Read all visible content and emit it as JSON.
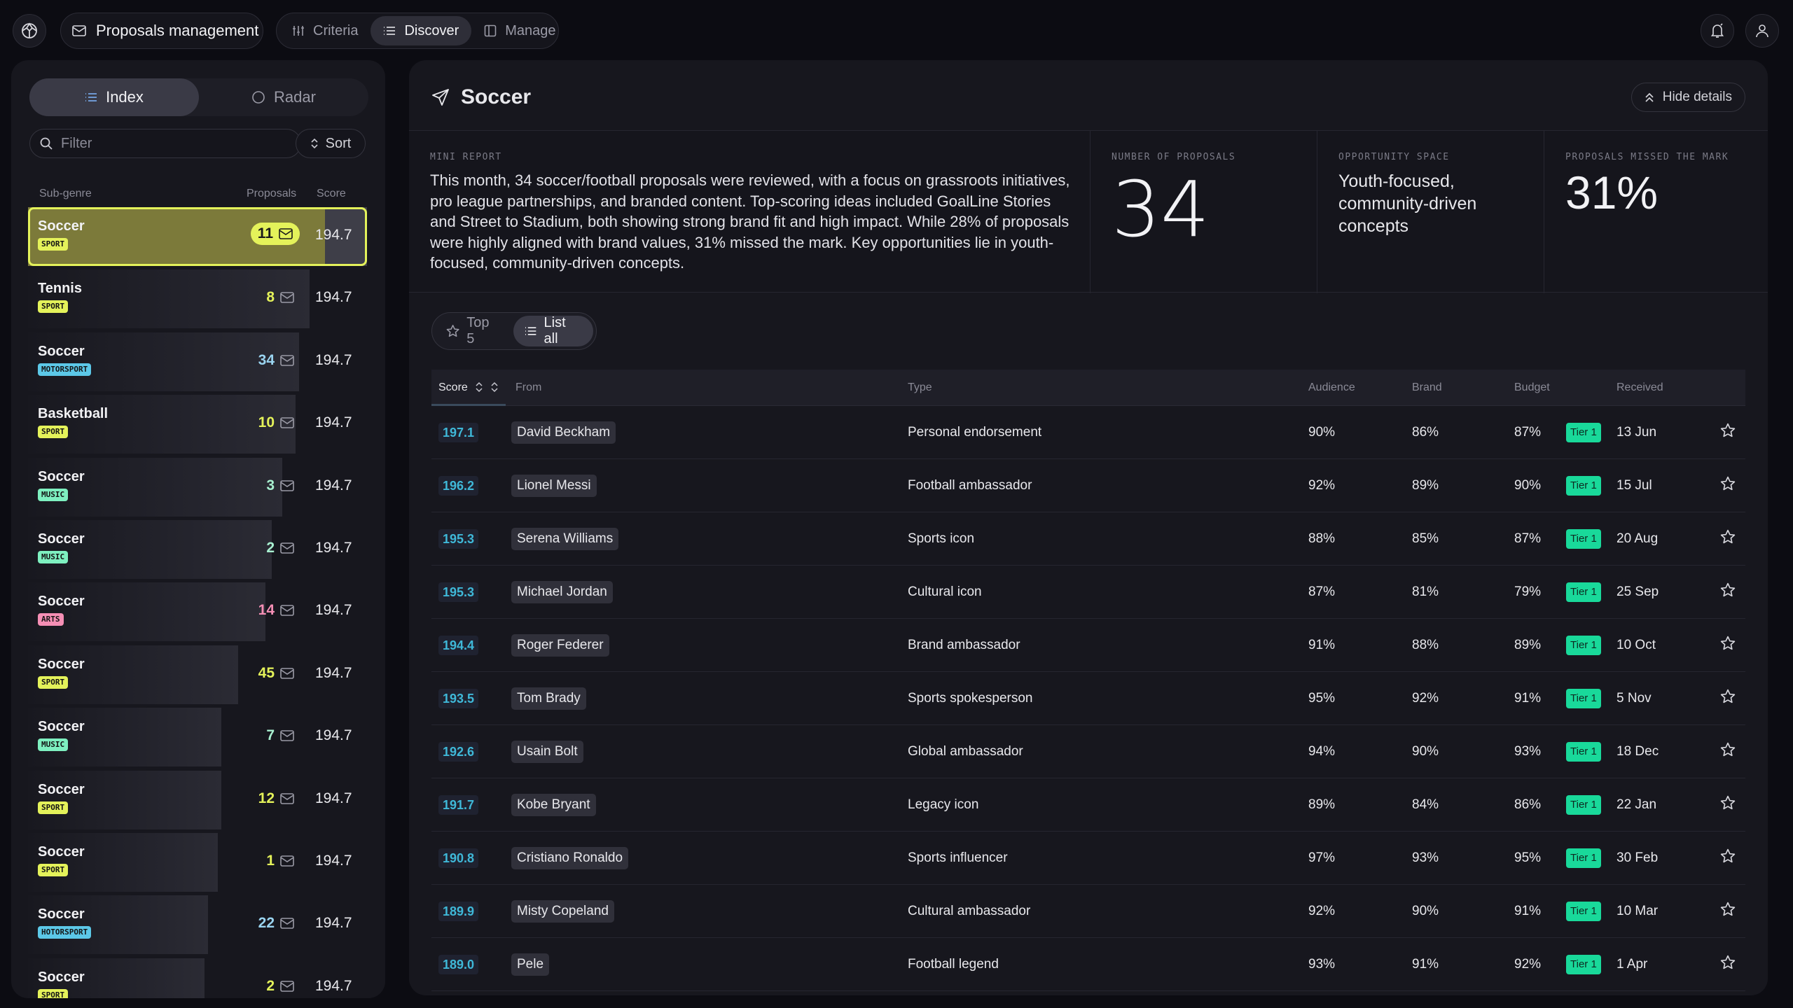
{
  "topbar": {
    "app_title": "Proposals management",
    "tabs": [
      {
        "label": "Criteria"
      },
      {
        "label": "Discover"
      },
      {
        "label": "Manage"
      }
    ]
  },
  "sidebar": {
    "segments": [
      {
        "label": "Index"
      },
      {
        "label": "Radar"
      }
    ],
    "filter_placeholder": "Filter",
    "sort_label": "Sort",
    "columns": {
      "subgenre": "Sub-genre",
      "proposals": "Proposals",
      "score": "Score"
    },
    "items": [
      {
        "name": "Soccer",
        "tag": "SPORT",
        "count": "11",
        "score": "194.7",
        "fill": 0.9
      },
      {
        "name": "Tennis",
        "tag": "SPORT",
        "count": "8",
        "score": "194.7",
        "fill": 0.83
      },
      {
        "name": "Soccer",
        "tag": "MOTORSPORT",
        "count": "34",
        "score": "194.7",
        "fill": 0.8
      },
      {
        "name": "Basketball",
        "tag": "SPORT",
        "count": "10",
        "score": "194.7",
        "fill": 0.79
      },
      {
        "name": "Soccer",
        "tag": "MUSIC",
        "count": "3",
        "score": "194.7",
        "fill": 0.75
      },
      {
        "name": "Soccer",
        "tag": "MUSIC",
        "count": "2",
        "score": "194.7",
        "fill": 0.72
      },
      {
        "name": "Soccer",
        "tag": "ARTS",
        "count": "14",
        "score": "194.7",
        "fill": 0.7
      },
      {
        "name": "Soccer",
        "tag": "SPORT",
        "count": "45",
        "score": "194.7",
        "fill": 0.62
      },
      {
        "name": "Soccer",
        "tag": "MUSIC",
        "count": "7",
        "score": "194.7",
        "fill": 0.57
      },
      {
        "name": "Soccer",
        "tag": "SPORT",
        "count": "12",
        "score": "194.7",
        "fill": 0.57
      },
      {
        "name": "Soccer",
        "tag": "SPORT",
        "count": "1",
        "score": "194.7",
        "fill": 0.56
      },
      {
        "name": "Soccer",
        "tag": "HOTORSPORT",
        "count": "22",
        "score": "194.7",
        "fill": 0.53
      },
      {
        "name": "Soccer",
        "tag": "SPORT",
        "count": "2",
        "score": "194.7",
        "fill": 0.52
      }
    ]
  },
  "main": {
    "title": "Soccer",
    "hide_details_label": "Hide details",
    "report": {
      "mini_label": "MINI REPORT",
      "mini_text": "This month, 34 soccer/football proposals were reviewed, with a focus on grassroots initiatives, pro league partnerships, and branded content. Top-scoring ideas included GoalLine Stories and Street to Stadium, both showing strong brand fit and high impact. While 28% of proposals were highly aligned with brand values, 31% missed the mark. Key opportunities lie in youth-focused, community-driven concepts.",
      "num_label": "NUMBER OF PROPOSALS",
      "num_value": "34",
      "opp_label": "OPPORTUNITY SPACE",
      "opp_text": "Youth-focused, community-driven concepts",
      "missed_label": "PROPOSALS MISSED THE MARK",
      "missed_value": "31%"
    },
    "toggle": [
      {
        "label": "Top 5"
      },
      {
        "label": "List all"
      }
    ],
    "table": {
      "headers": {
        "score": "Score",
        "from": "From",
        "type": "Type",
        "audience": "Audience",
        "brand": "Brand",
        "budget": "Budget",
        "received": "Received"
      },
      "rows": [
        {
          "score": "197.1",
          "from": "David Beckham",
          "type": "Personal endorsement",
          "audience": "90%",
          "brand": "86%",
          "budget": "87%",
          "tier": "Tier 1",
          "received": "13 Jun"
        },
        {
          "score": "196.2",
          "from": "Lionel Messi",
          "type": "Football ambassador",
          "audience": "92%",
          "brand": "89%",
          "budget": "90%",
          "tier": "Tier 1",
          "received": "15 Jul"
        },
        {
          "score": "195.3",
          "from": "Serena Williams",
          "type": "Sports icon",
          "audience": "88%",
          "brand": "85%",
          "budget": "87%",
          "tier": "Tier 1",
          "received": "20 Aug"
        },
        {
          "score": "195.3",
          "from": "Michael Jordan",
          "type": "Cultural icon",
          "audience": "87%",
          "brand": "81%",
          "budget": "79%",
          "tier": "Tier 1",
          "received": "25 Sep"
        },
        {
          "score": "194.4",
          "from": "Roger Federer",
          "type": "Brand ambassador",
          "audience": "91%",
          "brand": "88%",
          "budget": "89%",
          "tier": "Tier 1",
          "received": "10 Oct"
        },
        {
          "score": "193.5",
          "from": "Tom Brady",
          "type": "Sports spokesperson",
          "audience": "95%",
          "brand": "92%",
          "budget": "91%",
          "tier": "Tier 1",
          "received": "5 Nov"
        },
        {
          "score": "192.6",
          "from": "Usain Bolt",
          "type": "Global ambassador",
          "audience": "94%",
          "brand": "90%",
          "budget": "93%",
          "tier": "Tier 1",
          "received": "18 Dec"
        },
        {
          "score": "191.7",
          "from": "Kobe Bryant",
          "type": "Legacy icon",
          "audience": "89%",
          "brand": "84%",
          "budget": "86%",
          "tier": "Tier 1",
          "received": "22 Jan"
        },
        {
          "score": "190.8",
          "from": "Cristiano Ronaldo",
          "type": "Sports influencer",
          "audience": "97%",
          "brand": "93%",
          "budget": "95%",
          "tier": "Tier 1",
          "received": "30 Feb"
        },
        {
          "score": "189.9",
          "from": "Misty Copeland",
          "type": "Cultural ambassador",
          "audience": "92%",
          "brand": "90%",
          "budget": "91%",
          "tier": "Tier 1",
          "received": "10 Mar"
        },
        {
          "score": "189.0",
          "from": "Pele",
          "type": "Football legend",
          "audience": "93%",
          "brand": "91%",
          "budget": "92%",
          "tier": "Tier 1",
          "received": "1 Apr"
        }
      ]
    }
  },
  "colors": {
    "accent_yellow": "#e4f25a",
    "tier_green": "#19d99a",
    "score_cyan": "#3fb8d8",
    "tag_sport": "#e4f25a",
    "tag_motorsport": "#5cc8e8",
    "tag_music": "#7ef0c0",
    "tag_arts": "#f58fb5",
    "count_sport": "#e4f25a",
    "count_motorsport": "#9ad4f0",
    "count_music": "#a8f0d0",
    "count_arts": "#f58fb5"
  }
}
